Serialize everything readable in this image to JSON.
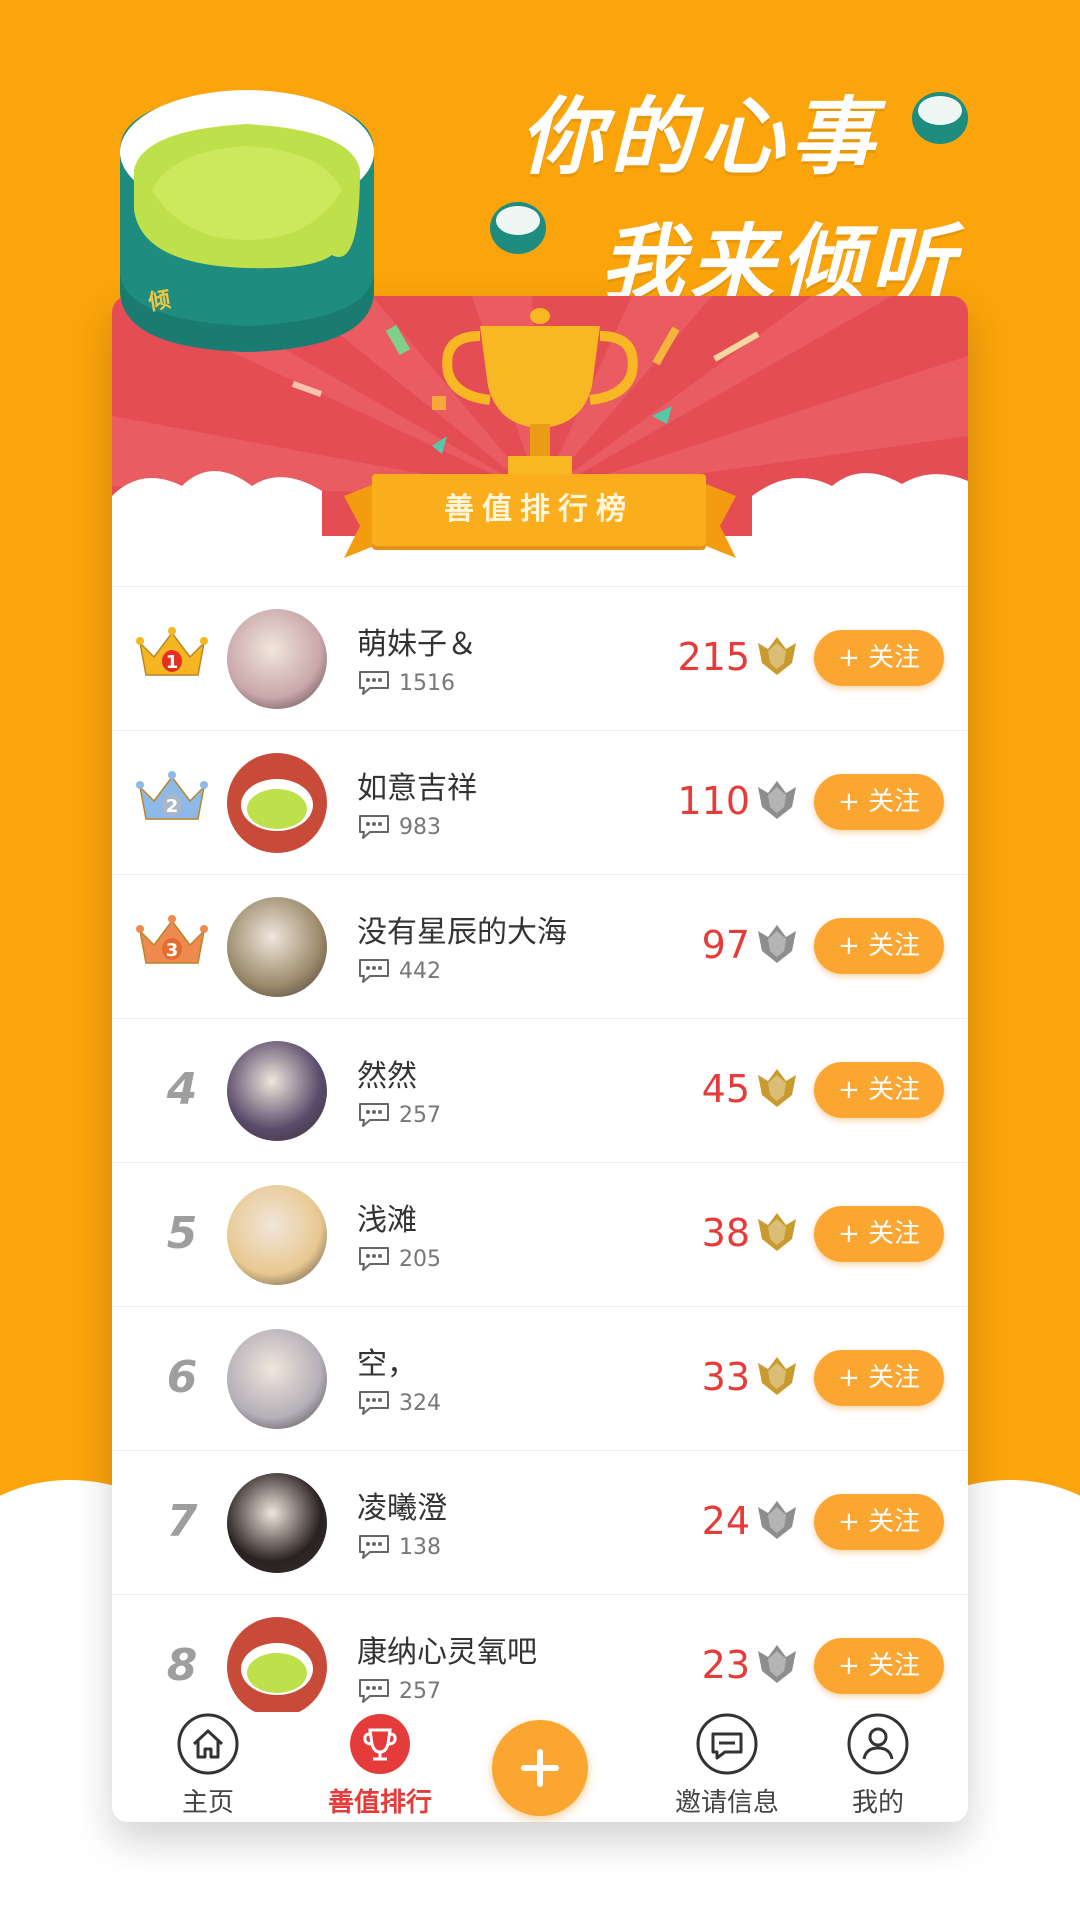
{
  "slogan": {
    "line1": "你的心事",
    "line2": "我来倾听"
  },
  "banner": {
    "title": "善值排行榜"
  },
  "follow_label": "+ 关注",
  "rows": [
    {
      "rank": "1",
      "name": "萌妹子＆",
      "comments": "1516",
      "score": "215",
      "medal": "gold",
      "avatar_color": "#c9a6a9"
    },
    {
      "rank": "2",
      "name": "如意吉祥",
      "comments": "983",
      "score": "110",
      "medal": "silver",
      "avatar_color": "logo"
    },
    {
      "rank": "3",
      "name": "没有星辰的大海",
      "comments": "442",
      "score": "97",
      "medal": "silver",
      "avatar_color": "#9a8a6a"
    },
    {
      "rank": "4",
      "name": "然然",
      "comments": "257",
      "score": "45",
      "medal": "gold",
      "avatar_color": "#5a4a6a"
    },
    {
      "rank": "5",
      "name": "浅滩",
      "comments": "205",
      "score": "38",
      "medal": "gold",
      "avatar_color": "#e8c890"
    },
    {
      "rank": "6",
      "name": "空，",
      "comments": "324",
      "score": "33",
      "medal": "gold",
      "avatar_color": "#b4afb8"
    },
    {
      "rank": "7",
      "name": "凌曦澄",
      "comments": "138",
      "score": "24",
      "medal": "silver",
      "avatar_color": "#2a2222"
    },
    {
      "rank": "8",
      "name": "康纳心灵氧吧",
      "comments": "257",
      "score": "23",
      "medal": "silver",
      "avatar_color": "logo"
    }
  ],
  "tabs": [
    {
      "label": "主页",
      "icon": "home-icon"
    },
    {
      "label": "善值排行",
      "icon": "trophy-icon",
      "active": true
    },
    {
      "label": "",
      "icon": "plus-icon"
    },
    {
      "label": "邀请信息",
      "icon": "message-icon"
    },
    {
      "label": "我的",
      "icon": "user-icon"
    }
  ],
  "colors": {
    "background": "#FBA40B",
    "banner": "#E54D55",
    "accent": "#FBA630",
    "score": "#E53B3B"
  }
}
